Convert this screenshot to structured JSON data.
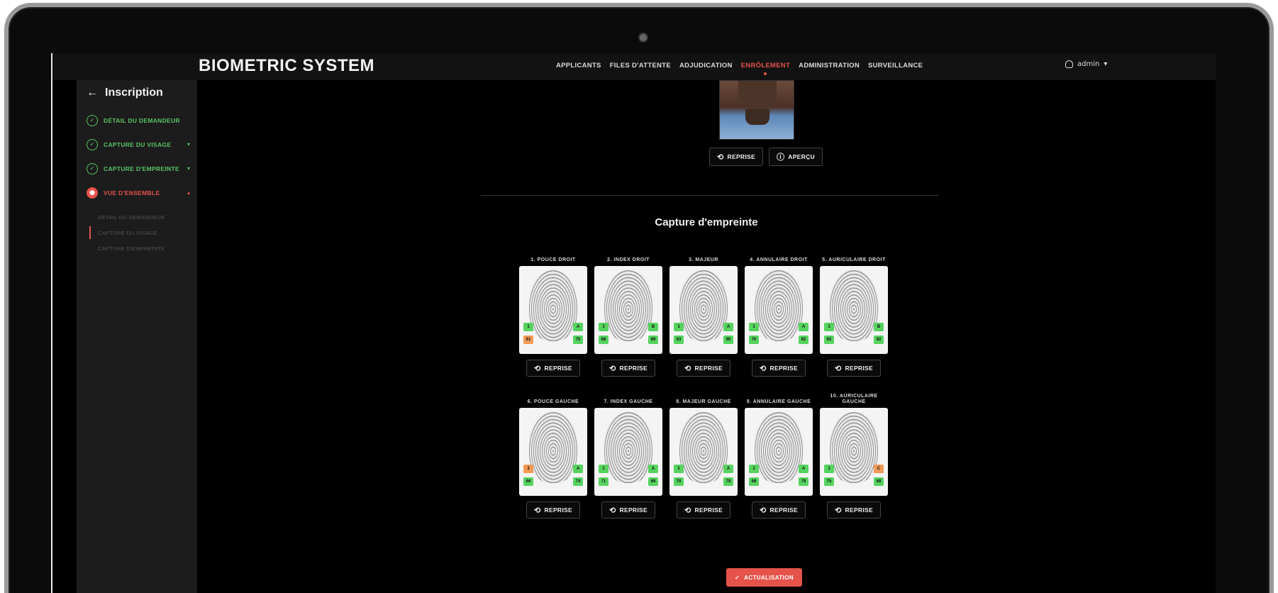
{
  "app": {
    "brand": "BIOMETRIC SYSTEM"
  },
  "nav": [
    {
      "label": "APPLICANTS",
      "active": false
    },
    {
      "label": "FILES D'ATTENTE",
      "active": false
    },
    {
      "label": "ADJUDICATION",
      "active": false
    },
    {
      "label": "ENRÔLEMENT",
      "active": true
    },
    {
      "label": "ADMINISTRATION",
      "active": false
    },
    {
      "label": "SURVEILLANCE",
      "active": false
    }
  ],
  "user": {
    "name": "admin"
  },
  "sidebar": {
    "back_label": "Inscription",
    "steps": [
      {
        "label": "DÉTAIL DU DEMANDEUR",
        "status": "done",
        "caret": ""
      },
      {
        "label": "CAPTURE DU VISAGE",
        "status": "done",
        "caret": "▾"
      },
      {
        "label": "CAPTURE D'EMPREINTE",
        "status": "done",
        "caret": "▾"
      },
      {
        "label": "VUE D'ENSEMBLE",
        "status": "current",
        "caret": "▴"
      }
    ],
    "substeps": [
      {
        "label": "DÉTAIL DU DEMANDEUR",
        "current": false
      },
      {
        "label": "CAPTURE DU VISAGE",
        "current": true
      },
      {
        "label": "CAPTURE D'EMPREINTE",
        "current": false
      }
    ]
  },
  "photo_actions": {
    "retake": "REPRISE",
    "preview": "APERÇU"
  },
  "section_title": "Capture d'empreinte",
  "fingers_right": [
    {
      "label": "1. POUCE DROIT",
      "tl": "1",
      "tr": "A",
      "bl": "61",
      "br": "75",
      "tl_c": "g",
      "tr_c": "g",
      "bl_c": "o",
      "br_c": "g",
      "action": "REPRISE"
    },
    {
      "label": "2. INDEX DROIT",
      "tl": "1",
      "tr": "B",
      "bl": "68",
      "br": "89",
      "tl_c": "g",
      "tr_c": "g",
      "bl_c": "g",
      "br_c": "g",
      "action": "REPRISE"
    },
    {
      "label": "3. MAJEUR",
      "tl": "1",
      "tr": "A",
      "bl": "63",
      "br": "90",
      "tl_c": "g",
      "tr_c": "g",
      "bl_c": "g",
      "br_c": "g",
      "action": "REPRISE"
    },
    {
      "label": "4. ANNULAIRE DROIT",
      "tl": "1",
      "tr": "A",
      "bl": "70",
      "br": "82",
      "tl_c": "g",
      "tr_c": "g",
      "bl_c": "g",
      "br_c": "g",
      "action": "REPRISE"
    },
    {
      "label": "5. AURICULAIRE DROIT",
      "tl": "1",
      "tr": "B",
      "bl": "65",
      "br": "92",
      "tl_c": "g",
      "tr_c": "g",
      "bl_c": "g",
      "br_c": "g",
      "action": "REPRISE"
    }
  ],
  "fingers_left": [
    {
      "label": "6. POUCE GAUCHE",
      "tl": "3",
      "tr": "A",
      "bl": "66",
      "br": "74",
      "tl_c": "o",
      "tr_c": "g",
      "bl_c": "g",
      "br_c": "g",
      "action": "REPRISE"
    },
    {
      "label": "7. INDEX GAUCHE",
      "tl": "1",
      "tr": "A",
      "bl": "71",
      "br": "89",
      "tl_c": "g",
      "tr_c": "g",
      "bl_c": "g",
      "br_c": "g",
      "action": "REPRISE"
    },
    {
      "label": "8. MAJEUR GAUCHE",
      "tl": "1",
      "tr": "A",
      "bl": "70",
      "br": "78",
      "tl_c": "g",
      "tr_c": "g",
      "bl_c": "g",
      "br_c": "g",
      "action": "REPRISE"
    },
    {
      "label": "9. ANNULAIRE GAUCHE",
      "tl": "1",
      "tr": "A",
      "bl": "68",
      "br": "79",
      "tl_c": "g",
      "tr_c": "g",
      "bl_c": "g",
      "br_c": "g",
      "action": "REPRISE"
    },
    {
      "label": "10. AURICULAIRE GAUCHE",
      "tl": "1",
      "tr": "C",
      "bl": "75",
      "br": "68",
      "tl_c": "g",
      "tr_c": "o",
      "bl_c": "g",
      "br_c": "g",
      "action": "REPRISE"
    }
  ],
  "update_label": "ACTUALISATION",
  "colors": {
    "accent": "#e5534b",
    "success": "#59c466",
    "warning": "#f29a55"
  }
}
